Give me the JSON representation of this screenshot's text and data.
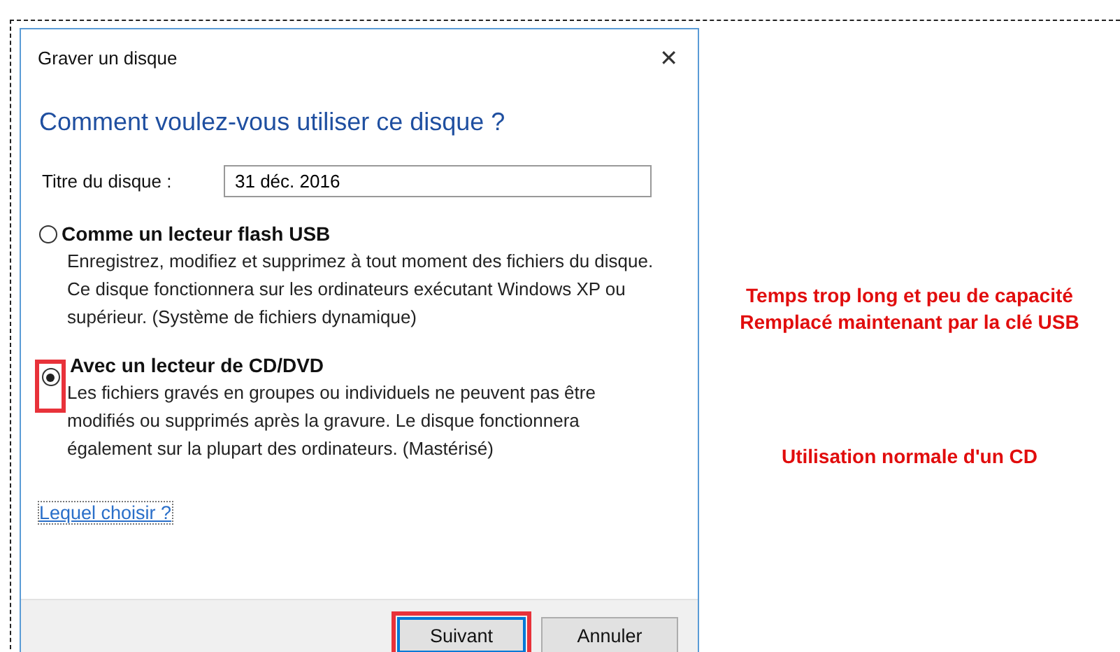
{
  "window": {
    "title": "Graver un disque",
    "close": "✕"
  },
  "heading": "Comment voulez-vous utiliser ce disque ?",
  "disc_title": {
    "label": "Titre du disque :",
    "value": "31 déc. 2016"
  },
  "options": [
    {
      "label": "Comme un lecteur flash USB",
      "description": "Enregistrez, modifiez et supprimez à tout moment des fichiers du disque. Ce disque fonctionnera sur les ordinateurs exécutant Windows XP ou supérieur. (Système de fichiers dynamique)",
      "selected": false,
      "highlighted": false
    },
    {
      "label": "Avec un lecteur de CD/DVD",
      "description": "Les fichiers gravés en groupes ou individuels ne peuvent pas être modifiés ou supprimés après la gravure. Le disque fonctionnera également sur la plupart des ordinateurs. (Mastérisé)",
      "selected": true,
      "highlighted": true
    }
  ],
  "help_link": "Lequel choisir ?",
  "buttons": [
    {
      "label": "Suivant",
      "highlighted": true
    },
    {
      "label": "Annuler",
      "highlighted": false
    }
  ],
  "annotations": [
    {
      "lines": [
        "Temps trop long et peu de capacité",
        "Remplacé maintenant par la clé USB"
      ]
    },
    {
      "lines": [
        "Utilisation normale d'un CD"
      ]
    }
  ]
}
